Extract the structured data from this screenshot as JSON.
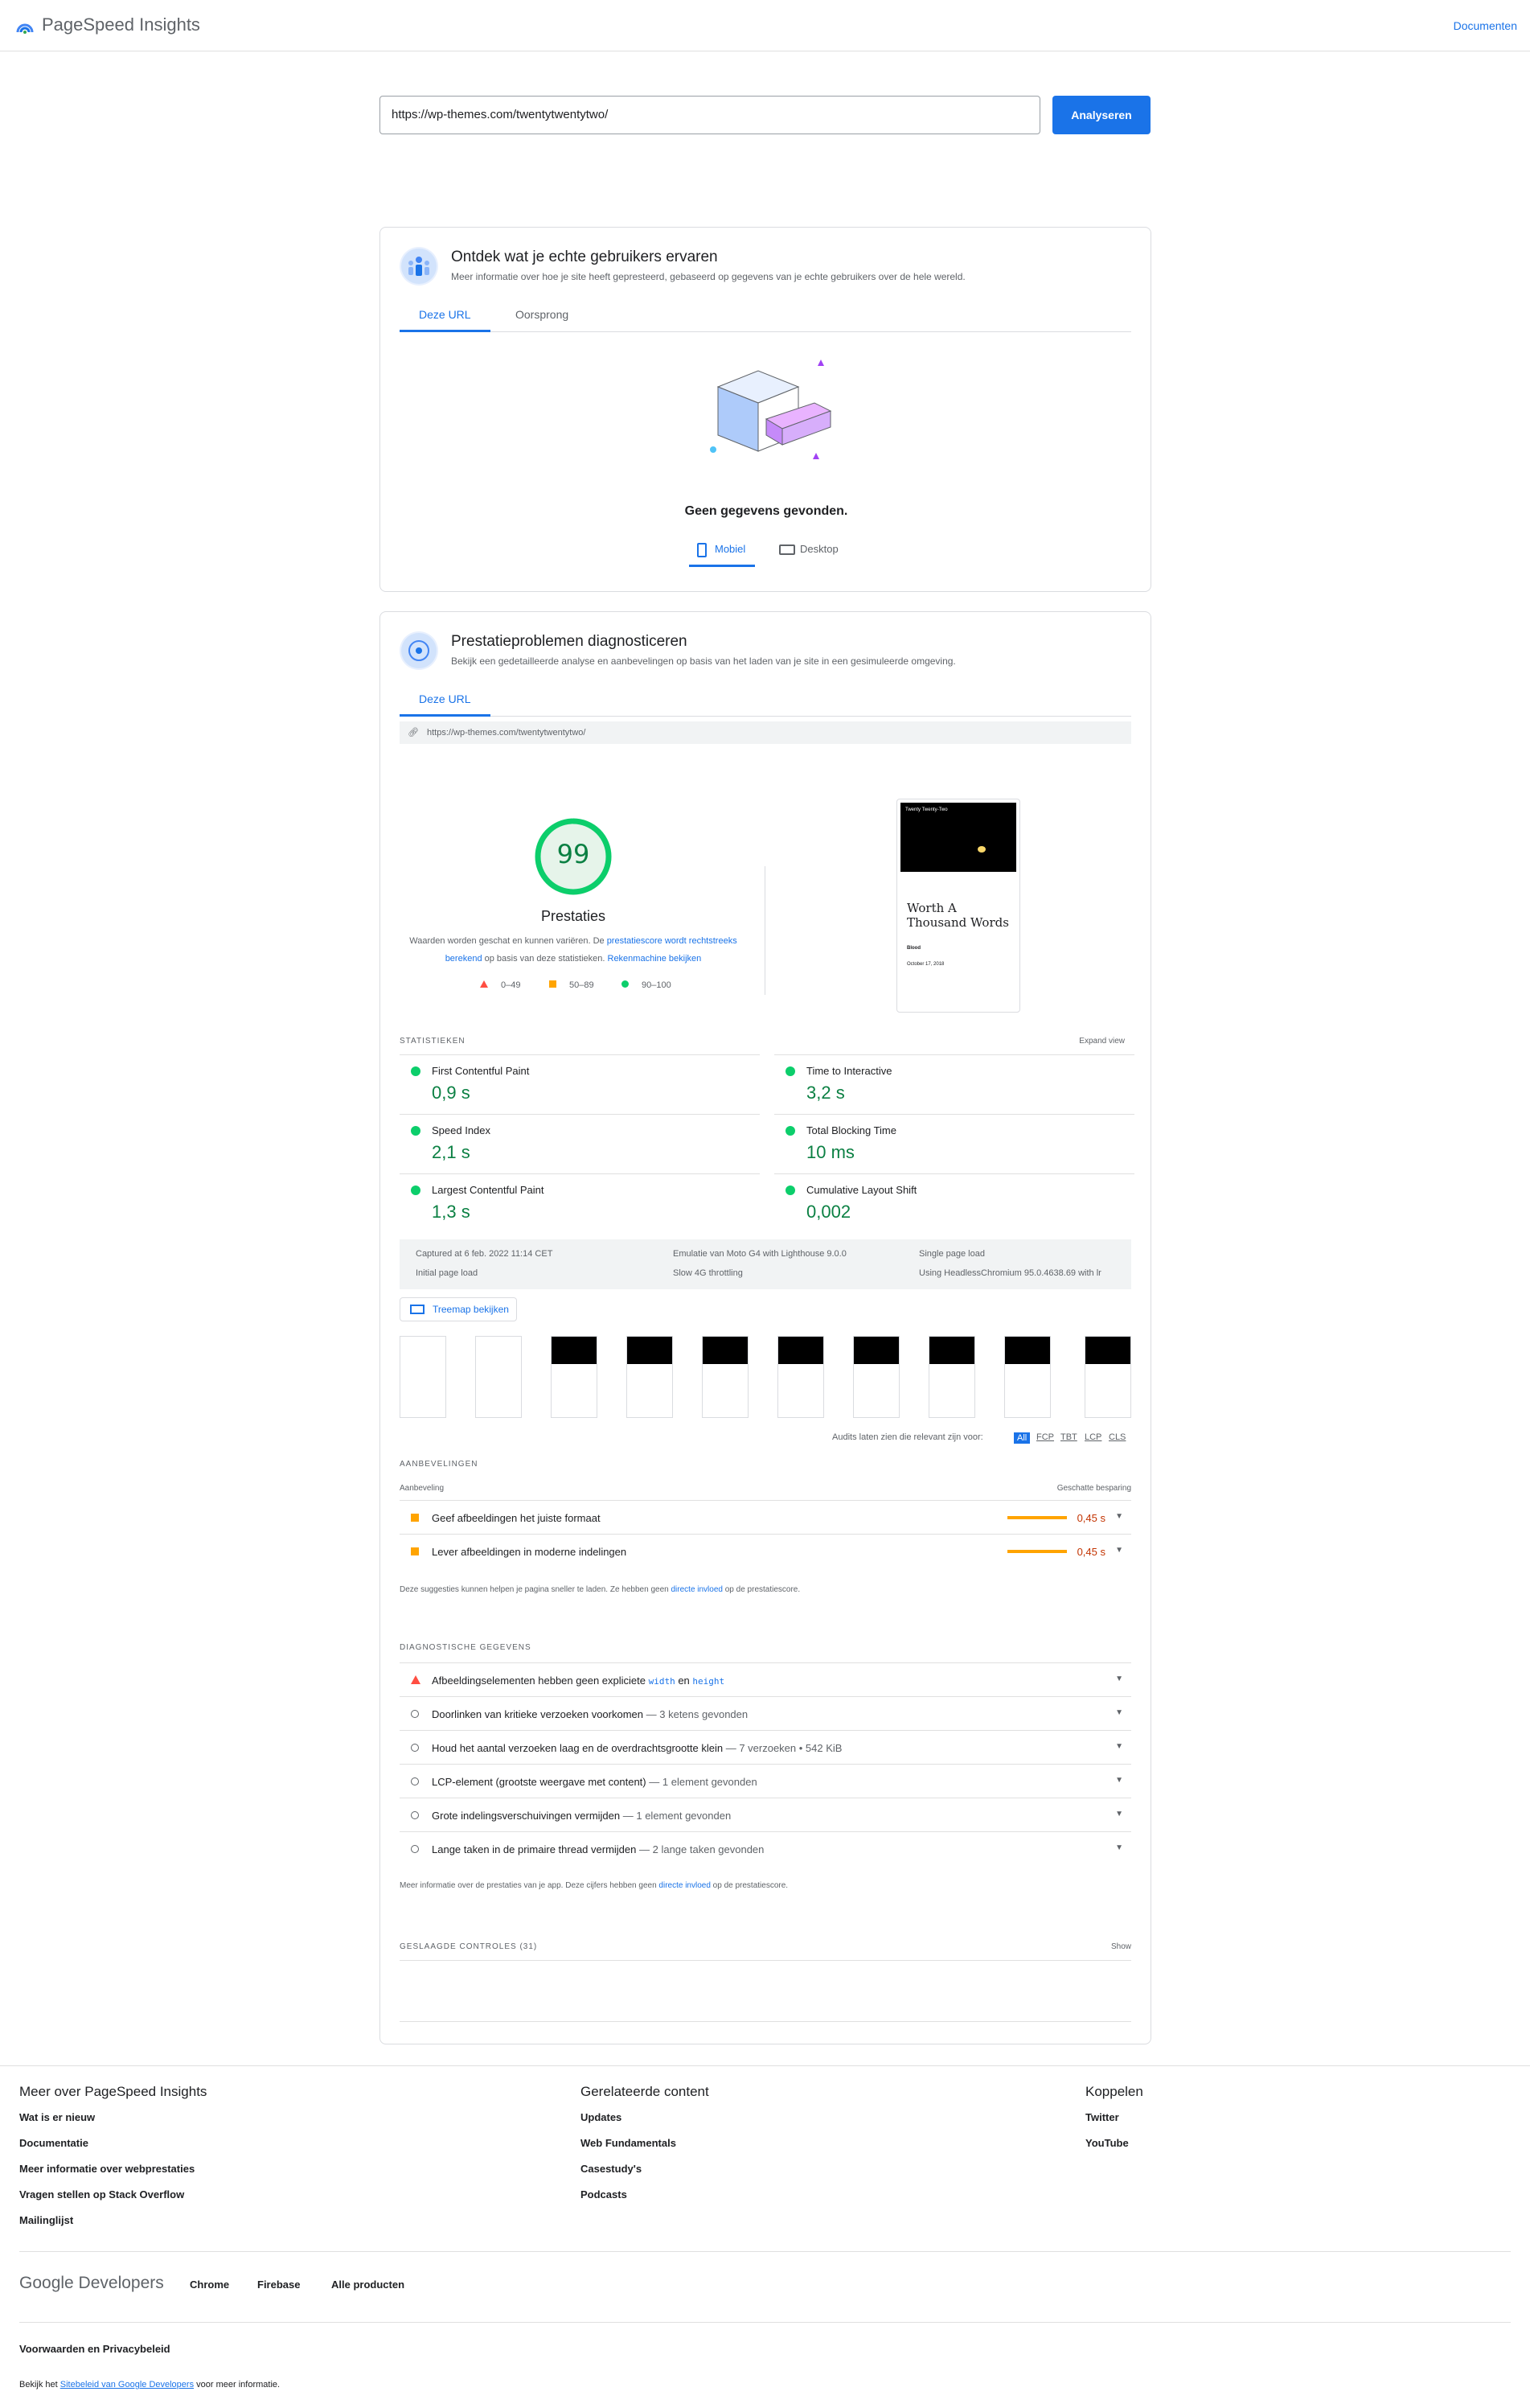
{
  "header": {
    "title": "PageSpeed Insights",
    "docs_link": "Documenten"
  },
  "search": {
    "url": "https://wp-themes.com/twentytwentytwo/",
    "button": "Analyseren"
  },
  "field": {
    "title": "Ontdek wat je echte gebruikers ervaren",
    "subtitle": "Meer informatie over hoe je site heeft gepresteerd, gebaseerd op gegevens van je echte gebruikers over de hele wereld.",
    "tabs": [
      "Deze URL",
      "Oorsprong"
    ],
    "nodata": "Geen gegevens gevonden.",
    "devices": [
      "Mobiel",
      "Desktop"
    ]
  },
  "lab": {
    "title": "Prestatieproblemen diagnosticeren",
    "subtitle": "Bekijk een gedetailleerde analyse en aanbevelingen op basis van het laden van je site in een gesimuleerde omgeving.",
    "tab": "Deze URL",
    "url": "https://wp-themes.com/twentytwentytwo/",
    "score": "99",
    "score_value": 0.99,
    "score_label": "Prestaties",
    "desc_1": "Waarden worden geschat en kunnen variëren. De ",
    "desc_link_1": "prestatiescore wordt rechtstreeks berekend",
    "desc_2": " op basis van deze statistieken. ",
    "desc_link_2": "Rekenmachine bekijken",
    "legend": [
      "0–49",
      "50–89",
      "90–100"
    ],
    "preview": {
      "site": "Twenty Twenty-Two",
      "heading_1": "Worth A",
      "heading_2": "Thousand Words",
      "meta": "Blood",
      "date": "October 17, 2018"
    },
    "stats_label": "STATISTIEKEN",
    "expand": "Expand view",
    "metrics": [
      {
        "name": "First Contentful Paint",
        "value": "0,9 s"
      },
      {
        "name": "Time to Interactive",
        "value": "3,2 s"
      },
      {
        "name": "Speed Index",
        "value": "2,1 s"
      },
      {
        "name": "Total Blocking Time",
        "value": "10 ms"
      },
      {
        "name": "Largest Contentful Paint",
        "value": "1,3 s"
      },
      {
        "name": "Cumulative Layout Shift",
        "value": "0,002"
      }
    ],
    "info": [
      "Captured at 6 feb. 2022 11:14 CET",
      "Emulatie van Moto G4 with Lighthouse 9.0.0",
      "Single page load",
      "Initial page load",
      "Slow 4G throttling",
      "Using HeadlessChromium 95.0.4638.69 with lr"
    ],
    "treemap": "Treemap bekijken",
    "filter_label": "Audits laten zien die relevant zijn voor:",
    "filters": [
      "All",
      "FCP",
      "TBT",
      "LCP",
      "CLS"
    ],
    "reco_label": "AANBEVELINGEN",
    "reco_col": "Aanbeveling",
    "reco_col2": "Geschatte besparing",
    "recos": [
      {
        "title": "Geef afbeeldingen het juiste formaat",
        "saving": "0,45 s"
      },
      {
        "title": "Lever afbeeldingen in moderne indelingen",
        "saving": "0,45 s"
      }
    ],
    "reco_note_1": "Deze suggesties kunnen helpen je pagina sneller te laden. Ze hebben geen ",
    "reco_note_link": "directe invloed",
    "reco_note_2": " op de prestatiescore.",
    "diag_label": "DIAGNOSTISCHE GEGEVENS",
    "diag_first": {
      "a": "Afbeeldingselementen hebben geen expliciete ",
      "code1": "width",
      "b": " en ",
      "code2": "height"
    },
    "diags": [
      {
        "title": "Doorlinken van kritieke verzoeken voorkomen",
        "detail": "— 3 ketens gevonden"
      },
      {
        "title": "Houd het aantal verzoeken laag en de overdrachtsgrootte klein",
        "detail": "— 7 verzoeken • 542 KiB"
      },
      {
        "title": "LCP-element (grootste weergave met content)",
        "detail": "— 1 element gevonden"
      },
      {
        "title": "Grote indelingsverschuivingen vermijden",
        "detail": "— 1 element gevonden"
      },
      {
        "title": "Lange taken in de primaire thread vermijden",
        "detail": "— 2 lange taken gevonden"
      }
    ],
    "diag_note_1": "Meer informatie over de prestaties van je app. Deze cijfers hebben geen ",
    "diag_note_link": "directe invloed",
    "diag_note_2": " op de prestatiescore.",
    "passed_label": "GESLAAGDE CONTROLES (31)",
    "show": "Show"
  },
  "footer": {
    "col1": {
      "title": "Meer over PageSpeed Insights",
      "links": [
        "Wat is er nieuw",
        "Documentatie",
        "Meer informatie over webprestaties",
        "Vragen stellen op Stack Overflow",
        "Mailinglijst"
      ]
    },
    "col2": {
      "title": "Gerelateerde content",
      "links": [
        "Updates",
        "Web Fundamentals",
        "Casestudy's",
        "Podcasts"
      ]
    },
    "col3": {
      "title": "Koppelen",
      "links": [
        "Twitter",
        "YouTube"
      ]
    },
    "brand": "Google Developers",
    "products": [
      "Chrome",
      "Firebase",
      "Alle producten"
    ],
    "terms": "Voorwaarden en Privacybeleid",
    "note_1": "Bekijk het ",
    "note_link": "Sitebeleid van Google Developers",
    "note_2": " voor meer informatie."
  }
}
